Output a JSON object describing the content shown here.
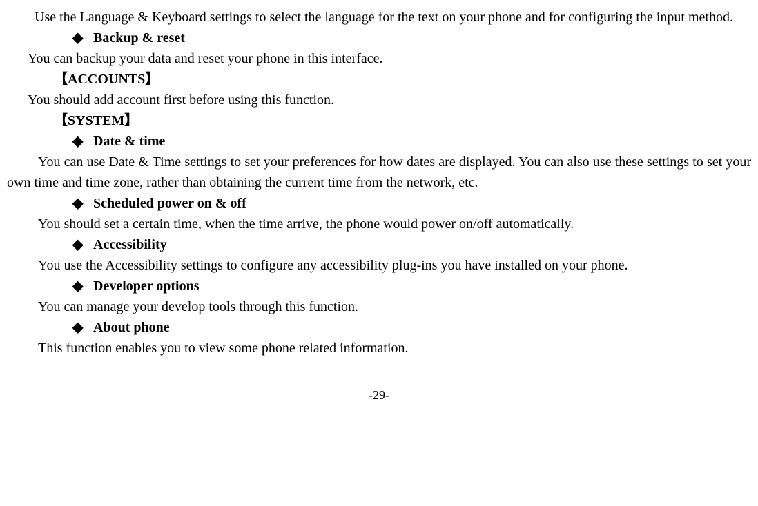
{
  "para1": "Use the Language & Keyboard settings to select the language for the text on your phone and for configuring the input method.",
  "bullet_backup": "Backup & reset",
  "para_backup": "You can backup your data and reset your phone in this interface.",
  "bracket_accounts": "【ACCOUNTS】",
  "para_accounts": "You should add account first before using this function.",
  "bracket_system": "【SYSTEM】",
  "bullet_date": "Date & time",
  "para_date": "You can use Date & Time settings to set your preferences for how dates are displayed. You can also use these settings to set your own time and time zone, rather than obtaining the current time from the network, etc.",
  "bullet_scheduled": "Scheduled power on & off",
  "para_scheduled": "You should set a certain time, when the time arrive, the phone would power on/off automatically.",
  "bullet_accessibility": "Accessibility",
  "para_accessibility": "You use the Accessibility settings to configure any accessibility plug-ins you have installed on your phone.",
  "bullet_developer": "Developer options",
  "para_developer": "You can manage your develop tools through this function.",
  "bullet_about": "About phone",
  "para_about": "This function enables you to view some phone related information.",
  "page_num": "-29-"
}
